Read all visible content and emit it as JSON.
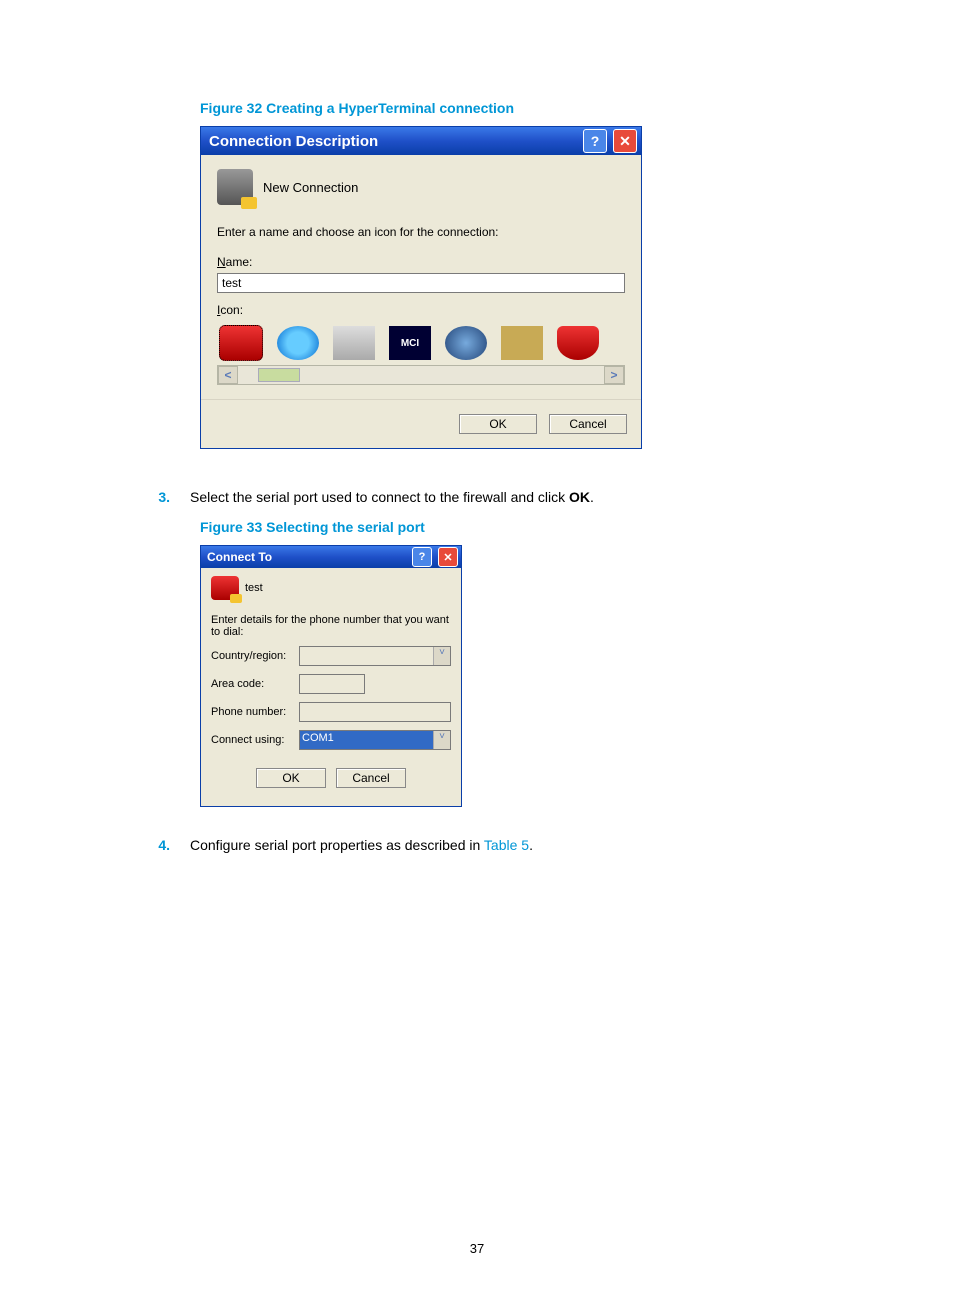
{
  "page_number": "37",
  "figure32": {
    "caption": "Figure 32 Creating a HyperTerminal connection",
    "title": "Connection Description",
    "header_text": "New Connection",
    "prompt": "Enter a name and choose an icon for the connection:",
    "name_label_pre": "N",
    "name_label_post": "ame:",
    "name_value": "test",
    "icon_label_pre": "I",
    "icon_label_post": "con:",
    "mci_text": "MCI",
    "ok_label": "OK",
    "cancel_label": "Cancel"
  },
  "step3": {
    "num": "3.",
    "text_pre": "Select the serial port used to connect to the firewall and click ",
    "bold": "OK",
    "text_post": "."
  },
  "figure33": {
    "caption": "Figure 33 Selecting the serial port",
    "title": "Connect To",
    "header_text": "test",
    "prompt": "Enter details for the phone number that you want to dial:",
    "country_label": "Country/region:",
    "area_label": "Area code:",
    "phone_label": "Phone number:",
    "connect_label": "Connect using:",
    "connect_value": "COM1",
    "ok_label": "OK",
    "cancel_label": "Cancel"
  },
  "step4": {
    "num": "4.",
    "text_pre": "Configure serial port properties as described in ",
    "link": "Table 5",
    "text_post": "."
  }
}
